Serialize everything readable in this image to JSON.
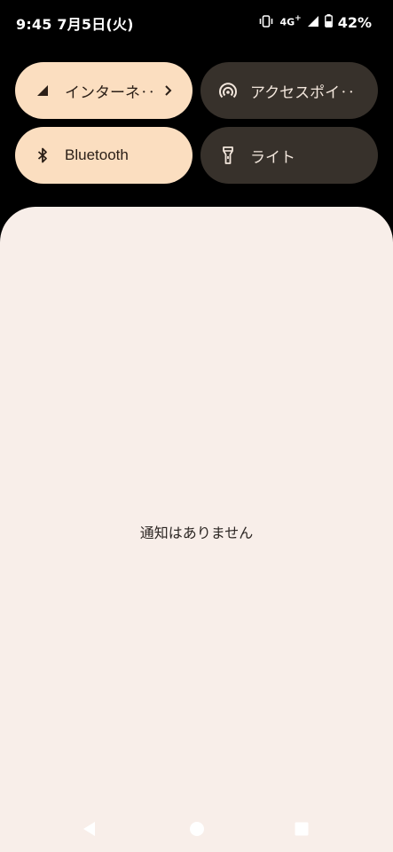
{
  "status_bar": {
    "time_date": "9:45 7月5日(火)",
    "network": "4G",
    "network_plus": "+",
    "battery": "42%"
  },
  "quick_tiles": [
    {
      "label": "インターネ‥",
      "icon": "signal-icon",
      "active": true,
      "has_chevron": true
    },
    {
      "label": "アクセスポイ‥",
      "icon": "hotspot-icon",
      "active": false
    },
    {
      "label": "Bluetooth",
      "icon": "bluetooth-icon",
      "active": true
    },
    {
      "label": "ライト",
      "icon": "flashlight-icon",
      "active": false
    }
  ],
  "notifications": {
    "empty_message": "通知はありません"
  },
  "colors": {
    "tile_active": "#fbdec0",
    "tile_inactive": "#37312b",
    "panel_bg": "#f8eee9"
  }
}
